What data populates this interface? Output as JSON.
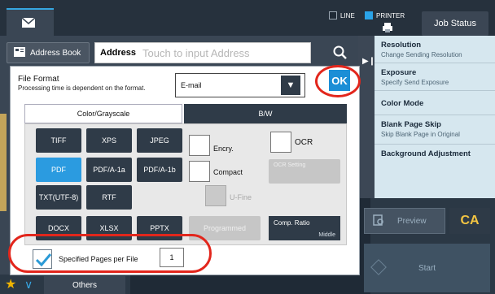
{
  "top_bar": {
    "line_label": "LINE",
    "printer_label": "PRINTER",
    "job_status_label": "Job Status"
  },
  "address_bar": {
    "address_book_label": "Address Book",
    "address_label": "Address",
    "address_placeholder": "Touch to input Address"
  },
  "right_panel": {
    "items": [
      {
        "title": "Resolution",
        "subtitle": "Change Sending Resolution"
      },
      {
        "title": "Exposure",
        "subtitle": "Specify Send Exposure"
      },
      {
        "title": "Color Mode",
        "subtitle": ""
      },
      {
        "title": "Blank Page Skip",
        "subtitle": "Skip Blank Page in Original"
      },
      {
        "title": "Background Adjustment",
        "subtitle": ""
      }
    ],
    "preview_label": "Preview",
    "ca_label": "CA",
    "start_label": "Start"
  },
  "bottom": {
    "others_label": "Others"
  },
  "dialog": {
    "title": "File Format",
    "note": "Processing time is dependent on the format.",
    "format_value": "E-mail",
    "ok_label": "OK",
    "tabs": {
      "color": "Color/Grayscale",
      "bw": "B/W"
    },
    "formats": {
      "tiff": "TIFF",
      "xps": "XPS",
      "jpeg": "JPEG",
      "pdf": "PDF",
      "pdfa1a": "PDF/A-1a",
      "pdfa1b": "PDF/A-1b",
      "txt": "TXT(UTF-8)",
      "rtf": "RTF",
      "docx": "DOCX",
      "xlsx": "XLSX",
      "pptx": "PPTX"
    },
    "selected_format": "PDF",
    "options": {
      "encry": "Encry.",
      "compact": "Compact",
      "ufine": "U-Fine",
      "programmed": "Programmed",
      "ocr": "OCR",
      "ocr_setting": "OCR Setting",
      "comp_ratio_label": "Comp. Ratio",
      "comp_ratio_value": "Middle"
    },
    "specified_pages": {
      "label": "Specified Pages per File",
      "checked": true,
      "value": "1"
    }
  },
  "colors": {
    "accent": "#2b9be0",
    "highlight_ring": "#e2261c",
    "dark": "#2f3b48"
  }
}
